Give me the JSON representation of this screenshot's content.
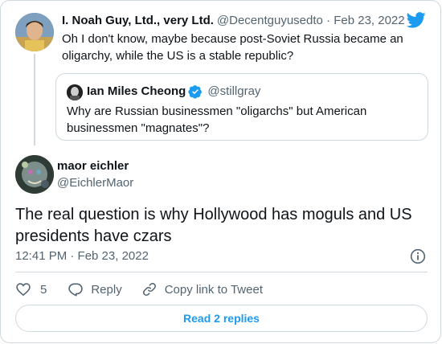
{
  "parent": {
    "name": "I. Noah Guy, Ltd., very Ltd.",
    "handle": "@Decentguyusedto",
    "date": "Feb 23, 2022",
    "handle_date": "@Decentguyusedto · Feb 23, 2022",
    "text": "Oh I don't know, maybe because post-Soviet Russia became an oligarchy, while the US is a stable republic?"
  },
  "quoted": {
    "name": "Ian Miles Cheong",
    "handle": "@stillgray",
    "text": "Why are Russian businessmen \"oligarchs\" but American businessmen \"magnates\"?"
  },
  "tweet": {
    "name": "maor eichler",
    "handle": "@EichlerMaor",
    "text": "The real question is why Hollywood has moguls and US presidents have czars",
    "timestamp": "12:41 PM · Feb 23, 2022"
  },
  "actions": {
    "like_count": "5",
    "reply_label": "Reply",
    "copy_label": "Copy link to Tweet"
  },
  "read_replies_label": "Read 2 replies",
  "colors": {
    "accent": "#1d9bf0",
    "text": "#0f1419",
    "secondary": "#536471",
    "border": "#cfd9de"
  }
}
